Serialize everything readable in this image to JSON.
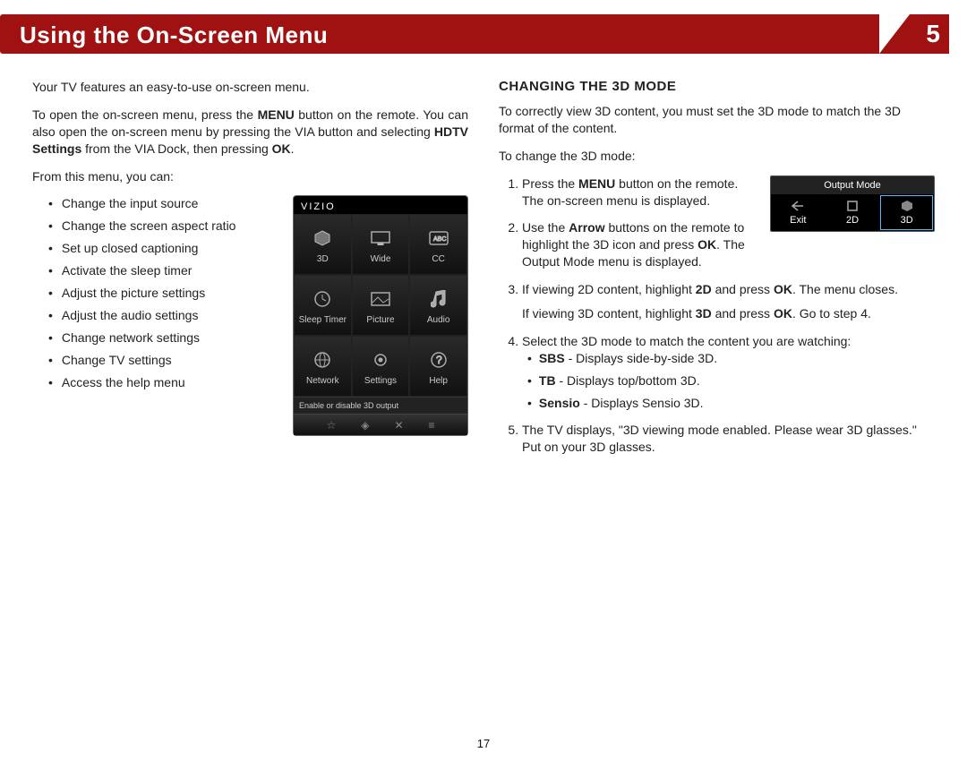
{
  "banner": {
    "title": "Using the On-Screen Menu",
    "chapter": "5"
  },
  "left": {
    "intro": "Your TV features an easy-to-use on-screen menu.",
    "open1": "To open the on-screen menu, press the ",
    "open_menu": "MENU",
    "open2": " button on the remote. You can also open the on-screen menu by pressing the VIA button and selecting ",
    "open_hdtv": "HDTV Settings",
    "open3": " from the VIA Dock, then pressing ",
    "open_ok": "OK",
    "open4": ".",
    "from": "From this menu, you can:",
    "bullets": [
      "Change the input source",
      "Change the screen aspect ratio",
      "Set up closed captioning",
      "Activate the sleep timer",
      "Adjust the picture settings",
      "Adjust the audio settings",
      "Change network settings",
      "Change TV settings",
      "Access the help menu"
    ]
  },
  "phone": {
    "brand": "VIZIO",
    "cells": [
      "3D",
      "Wide",
      "CC",
      "Sleep Timer",
      "Picture",
      "Audio",
      "Network",
      "Settings",
      "Help"
    ],
    "footer": "Enable or disable 3D output"
  },
  "right": {
    "heading": "CHANGING THE 3D MODE",
    "intro": "To correctly view 3D content, you must set the 3D mode to match the 3D format of the content.",
    "lead": "To change the 3D mode:",
    "s1a": "Press the ",
    "s1_menu": "MENU",
    "s1b": " button on the remote. The on-screen menu is displayed.",
    "s2a": "Use the ",
    "s2_arrow": "Arrow",
    "s2b": " buttons on the remote to highlight the 3D icon and press ",
    "s2_ok": "OK",
    "s2c": ". The Output Mode menu is displayed.",
    "s3a": "If viewing 2D content, highlight ",
    "s3_2d": "2D",
    "s3b": " and press ",
    "s3_ok": "OK",
    "s3c": ". The menu closes.",
    "s3d": "If viewing 3D content, highlight ",
    "s3_3d": "3D",
    "s3e": " and press ",
    "s3_ok2": "OK",
    "s3f": ". Go to step 4.",
    "s4": "Select the 3D mode to match the content you are watching:",
    "s4_sbs_b": "SBS",
    "s4_sbs": " - Displays side-by-side 3D.",
    "s4_tb_b": "TB",
    "s4_tb": " - Displays top/bottom 3D.",
    "s4_sen_b": "Sensio",
    "s4_sen": " - Displays Sensio 3D.",
    "s5": "The TV displays, \"3D viewing mode enabled. Please wear 3D glasses.\" Put on your 3D glasses."
  },
  "mode": {
    "title": "Output Mode",
    "exit": "Exit",
    "two_d": "2D",
    "three_d": "3D"
  },
  "page": "17"
}
